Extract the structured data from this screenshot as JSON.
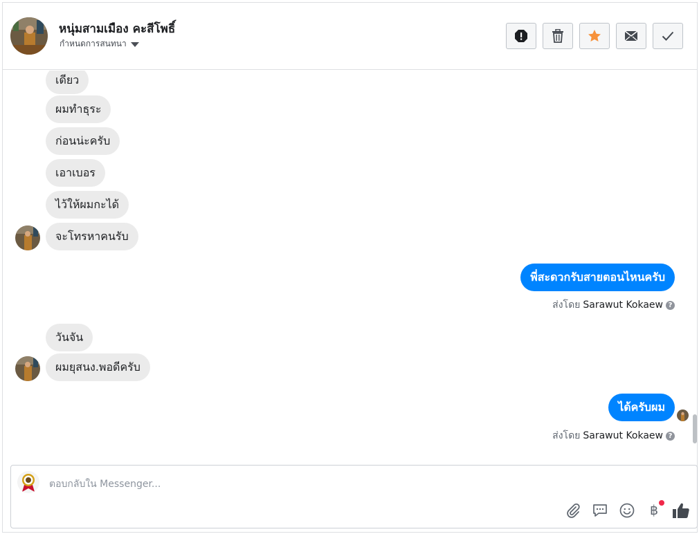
{
  "header": {
    "name": "หนุ่มสามเมือง คะสีโพธิ์",
    "conversation_settings_label": "กำหนดการสนทนา",
    "actions": [
      {
        "name": "report-button",
        "icon": "alert-icon"
      },
      {
        "name": "delete-button",
        "icon": "trash-icon"
      },
      {
        "name": "star-button",
        "icon": "star-icon"
      },
      {
        "name": "mark-unread-button",
        "icon": "envelope-icon"
      },
      {
        "name": "mark-done-button",
        "icon": "check-icon"
      }
    ]
  },
  "messages": [
    {
      "from": "contact",
      "text": "เดียว"
    },
    {
      "from": "contact",
      "text": "ผมทำธุระ"
    },
    {
      "from": "contact",
      "text": "ก่อนน่ะครับ"
    },
    {
      "from": "contact",
      "text": "เอาเบอร"
    },
    {
      "from": "contact",
      "text": "ไว้ให้ผมกะได้"
    },
    {
      "from": "contact",
      "text": "จะโทรหาคนรับ"
    },
    {
      "from": "page",
      "text": "พี่สะดวกรับสายตอนไหนครับ",
      "sent_by_label": "ส่งโดย",
      "sender": "Sarawut Kokaew"
    },
    {
      "from": "contact",
      "text": "วันจัน"
    },
    {
      "from": "contact",
      "text": "ผมยุสนง.พอดีครับ"
    },
    {
      "from": "page",
      "text": "ได้ครับผม",
      "sent_by_label": "ส่งโดย",
      "sender": "Sarawut Kokaew"
    }
  ],
  "help_glyph": "?",
  "composer": {
    "placeholder": "ตอบกลับใน Messenger...",
    "tools": [
      "paperclip-icon",
      "speech-bubble-icon",
      "smiley-icon",
      "baht-icon",
      "thumbs-up-icon"
    ],
    "baht_glyph": "฿"
  },
  "colors": {
    "outgoing_bubble": "#0084ff",
    "incoming_bubble": "#ebebeb",
    "star": "#f7923b",
    "notification_dot": "#f02849"
  }
}
